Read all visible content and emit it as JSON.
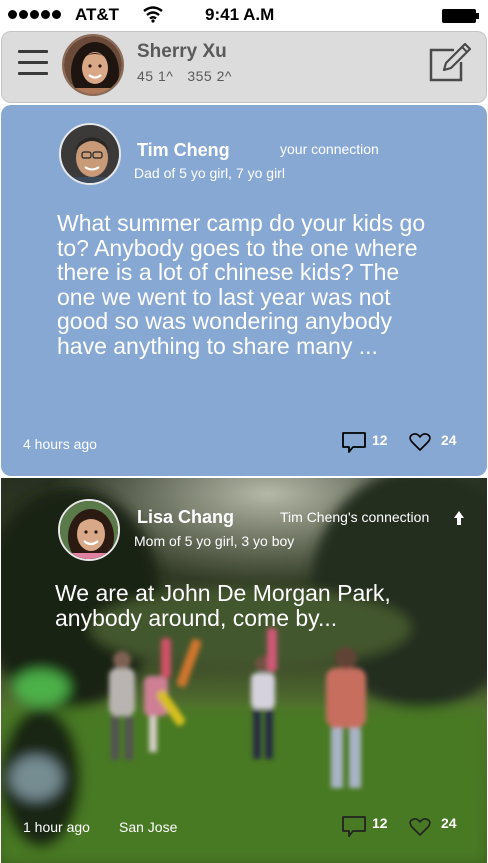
{
  "status_bar": {
    "carrier": "AT&T",
    "time": "9:41 A.M"
  },
  "header": {
    "user_name": "Sherry Xu",
    "stat_1": "45 1^",
    "stat_2": "355 2^"
  },
  "posts": [
    {
      "author": "Tim Cheng",
      "relation": "your  connection",
      "description": "Dad of 5 yo girl, 7 yo girl",
      "text_lines": [
        "What summer camp do your kids go",
        "to? Anybody goes to the one where",
        "there is a lot of chinese kids? The",
        "one we went to last year was not",
        "good so was wondering anybody",
        "have anything to share many ..."
      ],
      "time_ago": "4 hours ago",
      "comments": "12",
      "likes": "24",
      "background_color": "#87a8d3"
    },
    {
      "author": "Lisa Chang",
      "relation": "Tim Cheng's connection",
      "description": "Mom of 5 yo girl, 3 yo boy",
      "text_lines": [
        "We are at John De Morgan Park,",
        "anybody around, come by..."
      ],
      "time_ago": "1 hour ago",
      "location": "San Jose",
      "comments": "12",
      "likes": "24"
    }
  ],
  "icons": {
    "menu": "hamburger-menu-icon",
    "compose": "compose-icon",
    "comment": "speech-bubble-icon",
    "like": "heart-icon",
    "relation_arrow": "up-arrow-icon"
  }
}
